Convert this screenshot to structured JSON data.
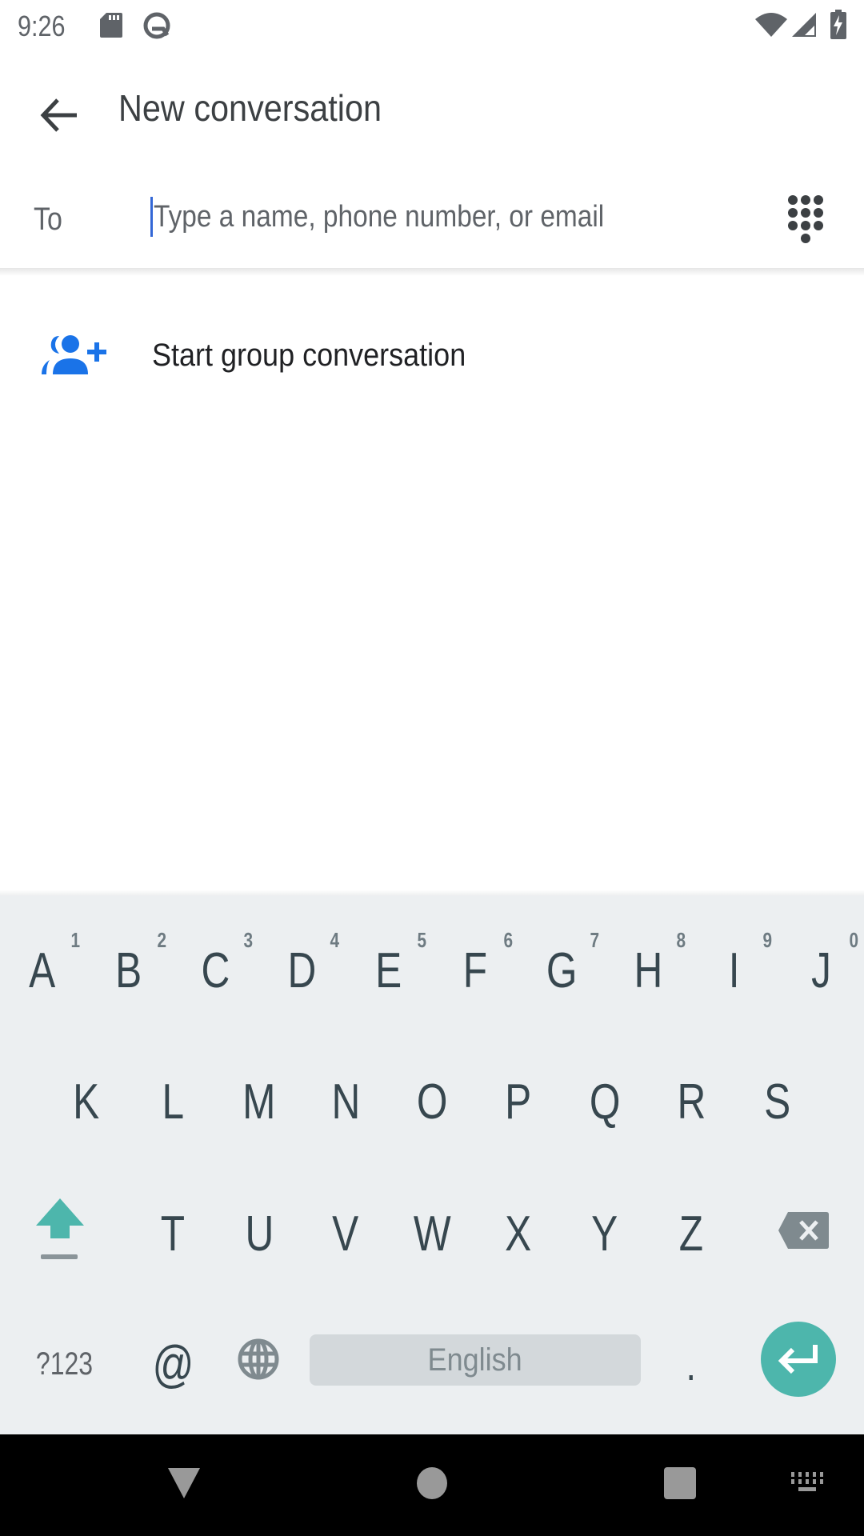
{
  "status_bar": {
    "time": "9:26",
    "left_icons": [
      "sd-card-icon",
      "q-beta-icon"
    ],
    "right_icons": [
      "wifi-icon",
      "cell-signal-icon",
      "battery-charging-icon"
    ]
  },
  "app_bar": {
    "back_icon": "arrow-back-icon",
    "title": "New conversation"
  },
  "recipient": {
    "label": "To",
    "value": "",
    "placeholder": "Type a name, phone number, or email",
    "dialpad_icon": "dialpad-icon"
  },
  "actions": [
    {
      "icon": "group-add-icon",
      "label": "Start group conversation",
      "color": "#1a73e8"
    }
  ],
  "keyboard": {
    "row1": [
      {
        "key": "A",
        "hint": "1"
      },
      {
        "key": "B",
        "hint": "2"
      },
      {
        "key": "C",
        "hint": "3"
      },
      {
        "key": "D",
        "hint": "4"
      },
      {
        "key": "E",
        "hint": "5"
      },
      {
        "key": "F",
        "hint": "6"
      },
      {
        "key": "G",
        "hint": "7"
      },
      {
        "key": "H",
        "hint": "8"
      },
      {
        "key": "I",
        "hint": "9"
      },
      {
        "key": "J",
        "hint": "0"
      }
    ],
    "row2": [
      "K",
      "L",
      "M",
      "N",
      "O",
      "P",
      "Q",
      "R",
      "S"
    ],
    "row3": [
      "T",
      "U",
      "V",
      "W",
      "X",
      "Y",
      "Z"
    ],
    "shift_icon": "shift-icon",
    "backspace_icon": "backspace-icon",
    "symbols_label": "?123",
    "at_label": "@",
    "language_icon": "globe-icon",
    "space_label": "English",
    "period_label": ".",
    "enter_icon": "enter-icon",
    "accent_color": "#4db6ac"
  },
  "nav_bar": {
    "buttons": [
      "back-triangle-icon",
      "home-circle-icon",
      "recents-square-icon",
      "keyboard-switch-icon"
    ]
  }
}
